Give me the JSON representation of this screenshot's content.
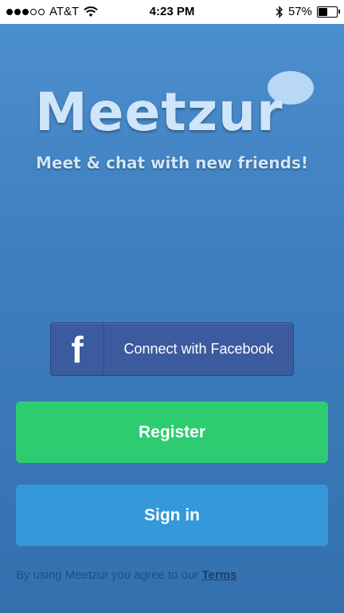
{
  "status_bar": {
    "carrier": "AT&T",
    "time": "4:23 PM",
    "battery": "57%",
    "battery_level": 0.57,
    "signal_bars_filled": 3,
    "signal_bars_total": 5,
    "icons": [
      "wifi-icon",
      "bluetooth-icon",
      "battery-icon"
    ]
  },
  "app": {
    "name": "Meetzur",
    "tagline": "Meet & chat with new friends!"
  },
  "buttons": {
    "facebook_label": "Connect with Facebook",
    "facebook_icon_glyph": "f",
    "register_label": "Register",
    "signin_label": "Sign in"
  },
  "footer": {
    "terms_prefix": "By using Meetzur you agree to our",
    "terms_link": "Terms"
  },
  "colors": {
    "background": "#4589c8",
    "facebook": "#3c5a9e",
    "register": "#2ecc71",
    "signin": "#3498db",
    "logo_text": "#cfe5f9"
  }
}
